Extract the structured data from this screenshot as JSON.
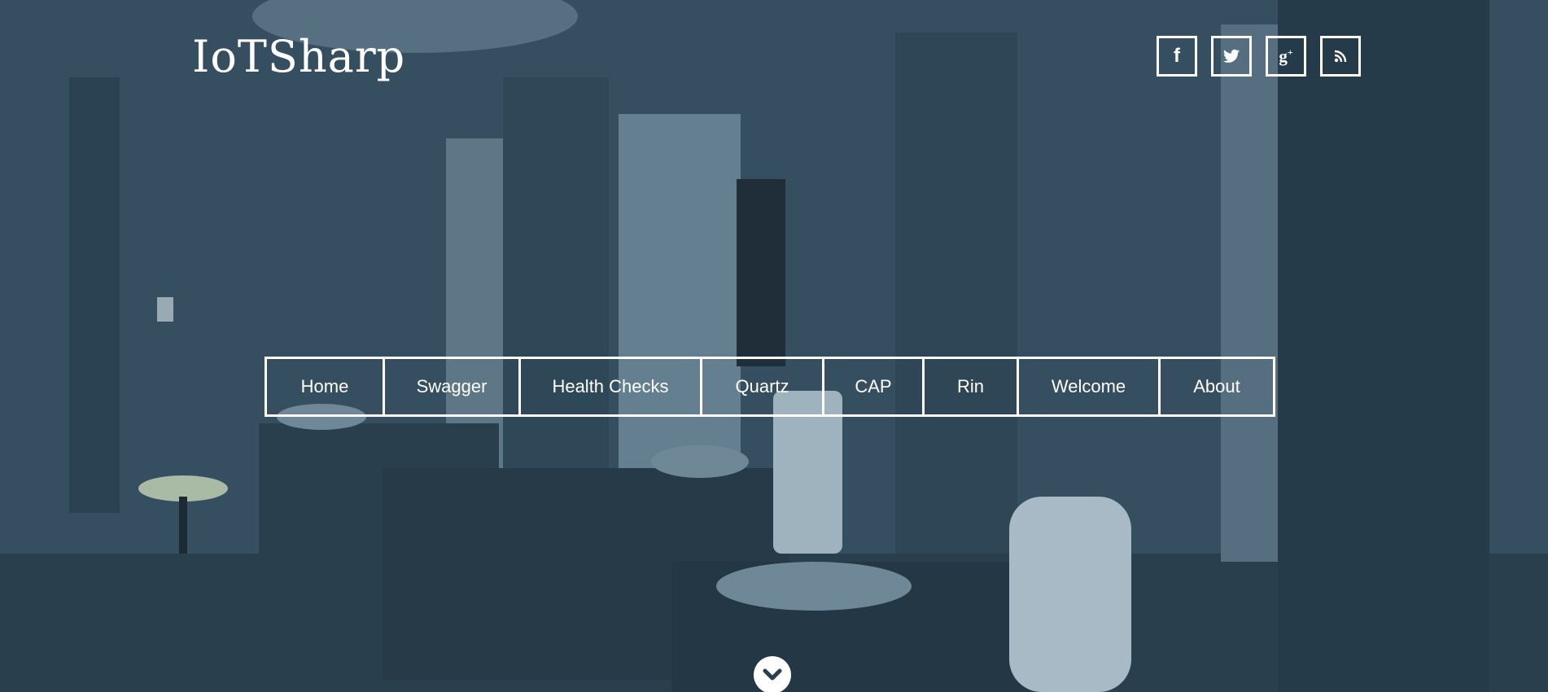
{
  "header": {
    "brand": "IoTSharp"
  },
  "social": [
    {
      "icon": "facebook-icon",
      "glyph": "f"
    },
    {
      "icon": "twitter-icon",
      "glyph": "t"
    },
    {
      "icon": "google-plus-icon",
      "glyph": "g+"
    },
    {
      "icon": "rss-icon",
      "glyph": "rss"
    }
  ],
  "nav": {
    "items": [
      {
        "label": "Home"
      },
      {
        "label": "Swagger"
      },
      {
        "label": "Health Checks"
      },
      {
        "label": "Quartz"
      },
      {
        "label": "CAP"
      },
      {
        "label": "Rin"
      },
      {
        "label": "Welcome"
      },
      {
        "label": "About"
      }
    ]
  },
  "scroll": {
    "icon": "chevron-down-icon"
  },
  "colors": {
    "overlay": "#2b3e4b",
    "foreground": "#ffffff"
  }
}
